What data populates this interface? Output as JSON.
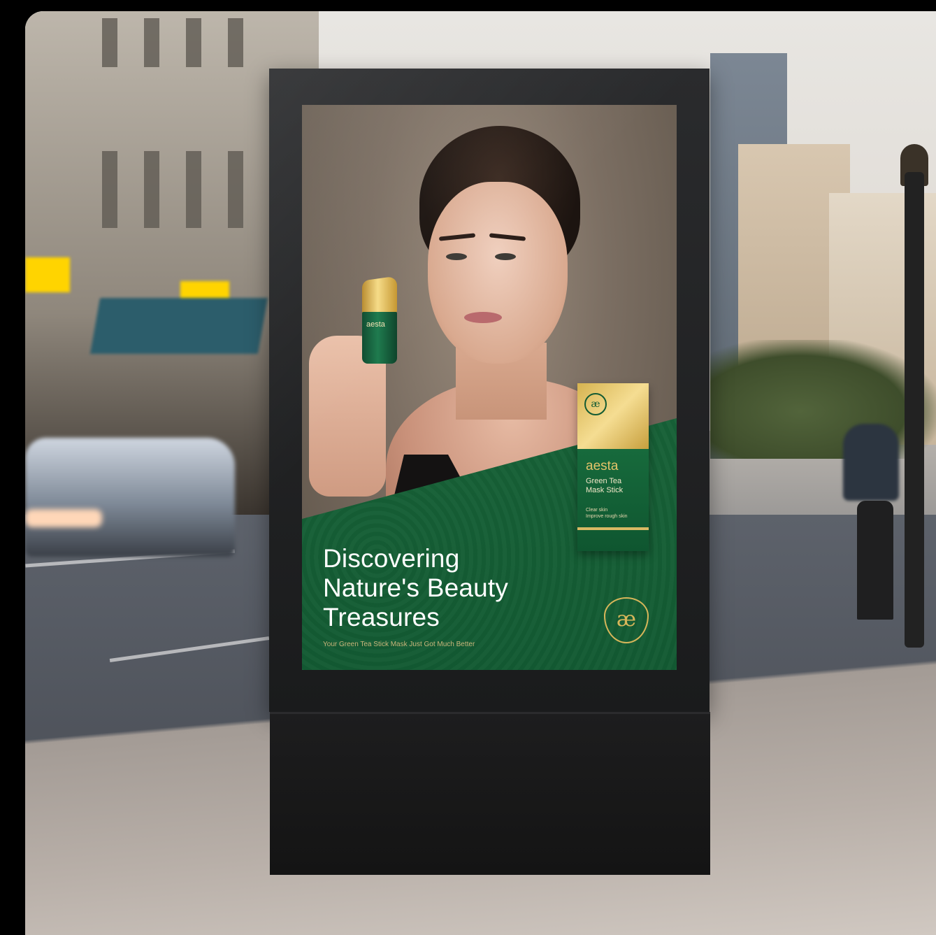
{
  "poster": {
    "headline_line1": "Discovering",
    "headline_line2": "Nature's Beauty",
    "headline_line3": "Treasures",
    "tagline": "Your Green Tea Stick Mask Just Got Much Better",
    "logo_glyph": "æ"
  },
  "product_box": {
    "emblem": "æ",
    "brand": "aesta",
    "name_line1": "Green Tea",
    "name_line2": "Mask Stick",
    "feature_line1": "Clear skin",
    "feature_line2": "Improve rough skin"
  },
  "held_stick": {
    "label": "aesta"
  },
  "colors": {
    "brand_green": "#135b33",
    "gold": "#d7b65a"
  },
  "icons": [
    "brand-logo-icon",
    "box-emblem-icon"
  ]
}
